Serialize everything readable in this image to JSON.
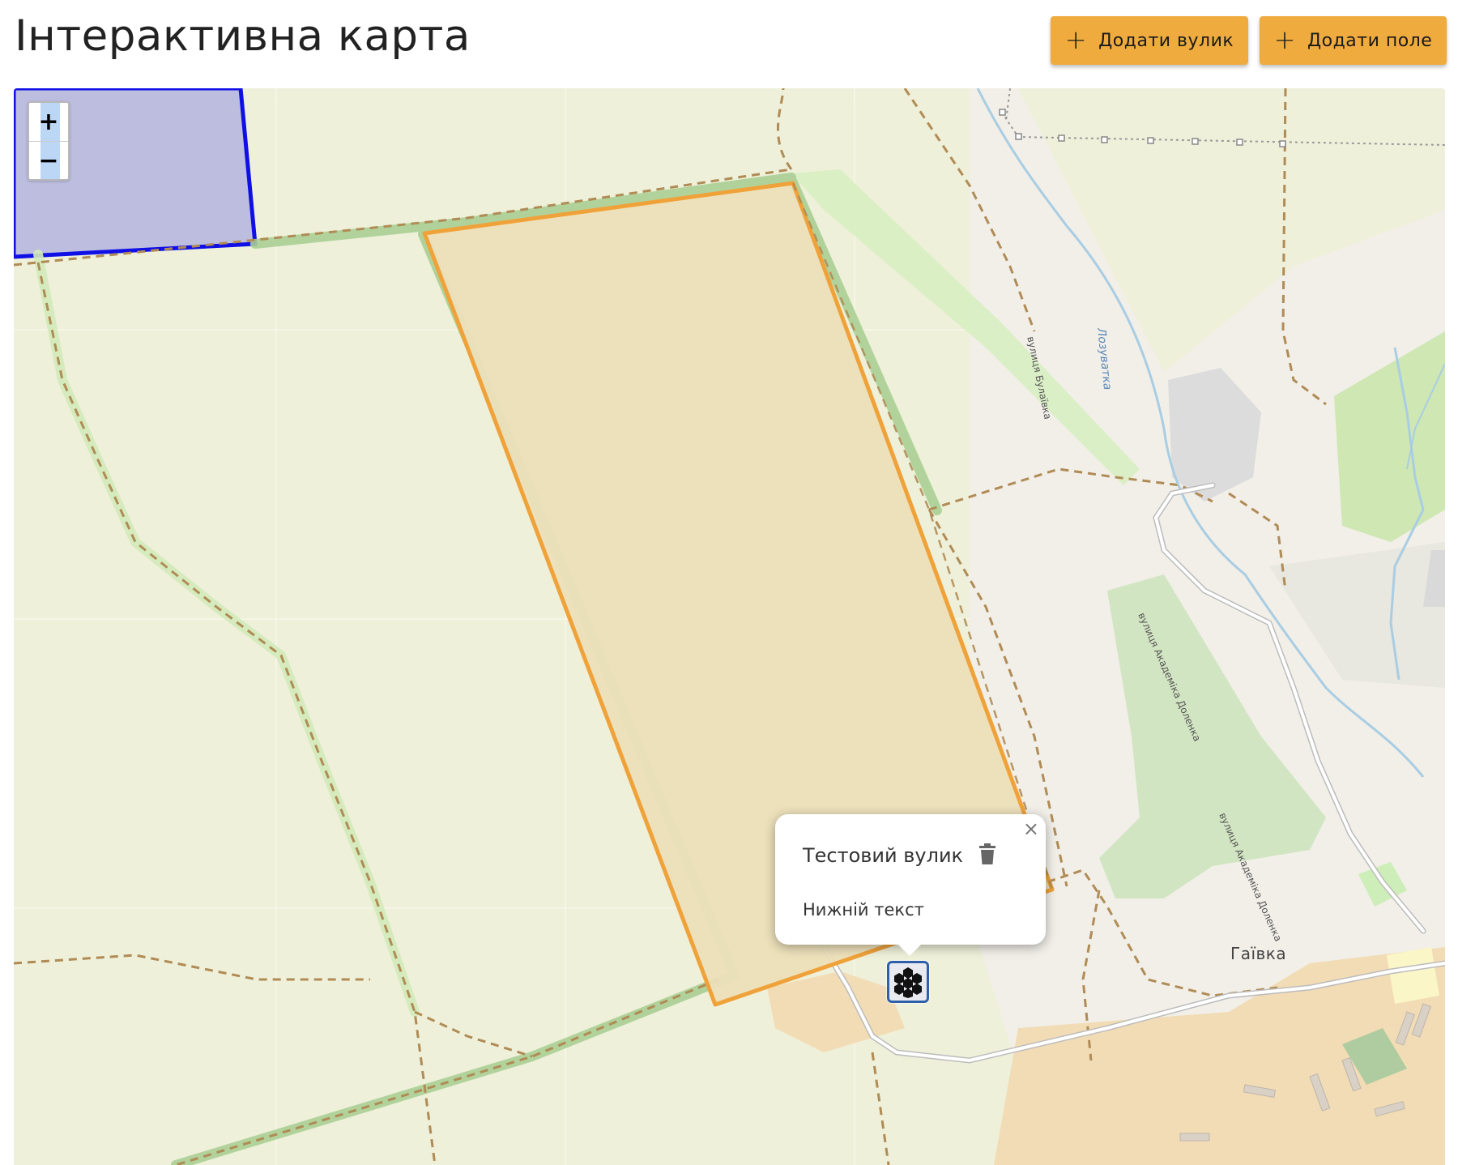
{
  "header": {
    "title": "Інтерактивна карта",
    "add_hive_label": "Додати вулик",
    "add_field_label": "Додати поле",
    "accent_color": "#f0ab3e"
  },
  "map": {
    "zoom_in_label": "+",
    "zoom_out_label": "−",
    "labels": {
      "street_bulaivka": "вулиця Булаївка",
      "river": "Лозуватка",
      "street_dolenka_1": "вулиця Академіка Доленка",
      "street_dolenka_2": "вулиця Академіка Доленка",
      "place": "Гаївка"
    },
    "field_color": "#f0ab3e",
    "other_field_color": "#0000ff",
    "marker_icon": "honeycomb-icon"
  },
  "popup": {
    "title": "Тестовий вулик",
    "subtitle": "Нижній текст",
    "close_symbol": "×",
    "delete_icon": "trash-icon"
  }
}
